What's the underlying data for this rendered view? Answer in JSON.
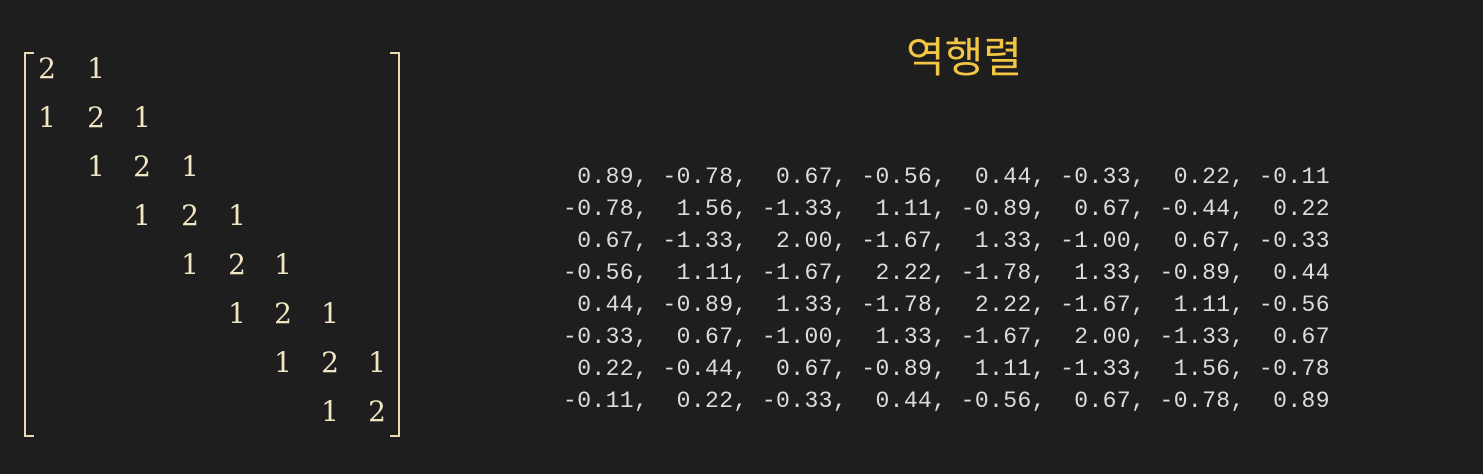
{
  "title": "역행렬",
  "matrix": {
    "rows": [
      [
        "2",
        "1",
        "",
        "",
        "",
        "",
        "",
        ""
      ],
      [
        "1",
        "2",
        "1",
        "",
        "",
        "",
        "",
        ""
      ],
      [
        "",
        "1",
        "2",
        "1",
        "",
        "",
        "",
        ""
      ],
      [
        "",
        "",
        "1",
        "2",
        "1",
        "",
        "",
        ""
      ],
      [
        "",
        "",
        "",
        "1",
        "2",
        "1",
        "",
        ""
      ],
      [
        "",
        "",
        "",
        "",
        "1",
        "2",
        "1",
        ""
      ],
      [
        "",
        "",
        "",
        "",
        "",
        "1",
        "2",
        "1"
      ],
      [
        "",
        "",
        "",
        "",
        "",
        "",
        "1",
        "2"
      ]
    ]
  },
  "inverse": {
    "rows": [
      " 0.89, -0.78,  0.67, -0.56,  0.44, -0.33,  0.22, -0.11",
      "-0.78,  1.56, -1.33,  1.11, -0.89,  0.67, -0.44,  0.22",
      " 0.67, -1.33,  2.00, -1.67,  1.33, -1.00,  0.67, -0.33",
      "-0.56,  1.11, -1.67,  2.22, -1.78,  1.33, -0.89,  0.44",
      " 0.44, -0.89,  1.33, -1.78,  2.22, -1.67,  1.11, -0.56",
      "-0.33,  0.67, -1.00,  1.33, -1.67,  2.00, -1.33,  0.67",
      " 0.22, -0.44,  0.67, -0.89,  1.11, -1.33,  1.56, -0.78",
      "-0.11,  0.22, -0.33,  0.44, -0.56,  0.67, -0.78,  0.89"
    ]
  },
  "colors": {
    "background": "#1e1e1e",
    "matrix_text": "#f1e6c3",
    "title": "#f2c544",
    "inverse_text": "#dcdcdc"
  }
}
